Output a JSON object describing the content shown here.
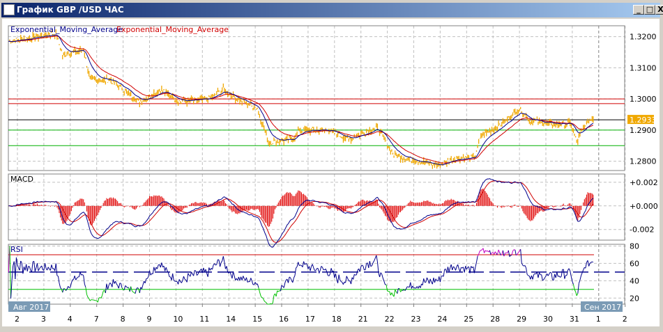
{
  "window": {
    "title": "График GBP /USD  ЧАС",
    "buttons": {
      "minimize": "_",
      "maximize": "□",
      "close": "X"
    }
  },
  "indicators": {
    "ema_fast_label": "Exponential_Moving_Average",
    "ema_slow_label": "Exponential_Moving_Average",
    "macd_label": "MACD",
    "rsi_label": "RSI"
  },
  "colors": {
    "bars": "#f0a800",
    "ema_fast": "#00008b",
    "ema_slow": "#d00000",
    "grid": "#c0c0c0",
    "rsi_low": "#00c000",
    "rsi_high": "#c000c0",
    "current_price_bg": "#f0a800"
  },
  "chart_data": {
    "type": "line",
    "symbol": "GBP/USD",
    "timeframe": "H1",
    "price_axis": {
      "ticks": [
        "1.3200",
        "1.3100",
        "1.3000",
        "1.2900",
        "1.2800"
      ],
      "values": [
        1.32,
        1.31,
        1.3,
        1.29,
        1.28
      ],
      "range": [
        1.277,
        1.3235
      ]
    },
    "current_price": "1.2933",
    "horizontal_levels": [
      {
        "value": 1.3,
        "color": "#d00000"
      },
      {
        "value": 1.2985,
        "color": "#d00000"
      },
      {
        "value": 1.2933,
        "color": "#000000"
      },
      {
        "value": 1.29,
        "color": "#00b000"
      },
      {
        "value": 1.285,
        "color": "#00b000"
      }
    ],
    "price_hours": [
      -8,
      35,
      41,
      60,
      66,
      85,
      111,
      130,
      149,
      174,
      187,
      199,
      218,
      228,
      250,
      256,
      282,
      301,
      326,
      342,
      364,
      383,
      396,
      415,
      421,
      440,
      456,
      465,
      484,
      503,
      508,
      516,
      523
    ],
    "price_values": [
      1.3185,
      1.321,
      1.314,
      1.316,
      1.306,
      1.306,
      1.299,
      1.303,
      1.299,
      1.3,
      1.303,
      1.3,
      1.297,
      1.286,
      1.287,
      1.29,
      1.29,
      1.287,
      1.291,
      1.282,
      1.28,
      1.2785,
      1.281,
      1.281,
      1.288,
      1.292,
      1.297,
      1.293,
      1.292,
      1.292,
      1.286,
      1.292,
      1.294
    ],
    "macd_axis": {
      "ticks": [
        "+0.002",
        "+0.000",
        "-0.002"
      ],
      "values": [
        0.002,
        0,
        -0.002
      ],
      "range": [
        -0.0029,
        0.0027
      ]
    },
    "rsi_axis": {
      "ticks": [
        "80",
        "60",
        "40",
        "20"
      ],
      "values": [
        80,
        60,
        40,
        20
      ],
      "range": [
        13,
        82
      ],
      "levels": [
        70,
        50,
        30
      ]
    },
    "x_ticks": [
      "2",
      "3",
      "4",
      "7",
      "8",
      "9",
      "10",
      "11",
      "14",
      "15",
      "16",
      "17",
      "18",
      "21",
      "22",
      "23",
      "24",
      "25",
      "28",
      "29",
      "30",
      "31",
      "1",
      "2"
    ],
    "month_labels": {
      "start": "Авг 2017",
      "end": "Сен 2017"
    }
  }
}
